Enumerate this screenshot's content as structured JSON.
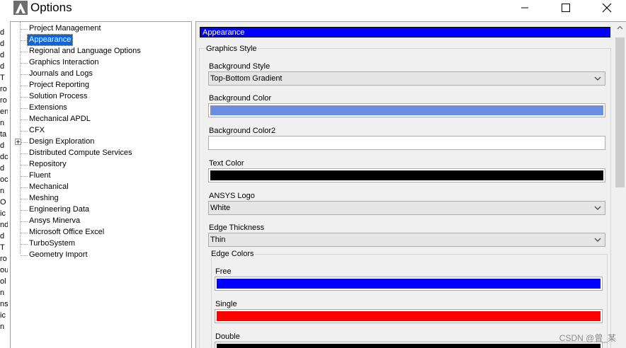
{
  "window": {
    "title": "Options",
    "controls": [
      "minimize",
      "maximize",
      "close"
    ]
  },
  "background_fragments": [
    "d",
    "d",
    "d",
    "d",
    "T",
    "ro",
    "ro",
    "en",
    "n",
    "ta",
    "d",
    "dc",
    "d",
    "oc",
    "n",
    "O",
    "ic",
    "nd",
    "d",
    "T",
    "ro",
    "ou",
    "ol",
    "n",
    "ns",
    "ic",
    "n"
  ],
  "tree": {
    "items": [
      {
        "label": "Project Management",
        "selected": false,
        "expandable": false
      },
      {
        "label": "Appearance",
        "selected": true,
        "expandable": false
      },
      {
        "label": "Regional and Language Options",
        "selected": false,
        "expandable": false
      },
      {
        "label": "Graphics Interaction",
        "selected": false,
        "expandable": false
      },
      {
        "label": "Journals and Logs",
        "selected": false,
        "expandable": false
      },
      {
        "label": "Project Reporting",
        "selected": false,
        "expandable": false
      },
      {
        "label": "Solution Process",
        "selected": false,
        "expandable": false
      },
      {
        "label": "Extensions",
        "selected": false,
        "expandable": false
      },
      {
        "label": "Mechanical APDL",
        "selected": false,
        "expandable": false
      },
      {
        "label": "CFX",
        "selected": false,
        "expandable": false
      },
      {
        "label": "Design Exploration",
        "selected": false,
        "expandable": true
      },
      {
        "label": "Distributed Compute Services",
        "selected": false,
        "expandable": false
      },
      {
        "label": "Repository",
        "selected": false,
        "expandable": false
      },
      {
        "label": "Fluent",
        "selected": false,
        "expandable": false
      },
      {
        "label": "Mechanical",
        "selected": false,
        "expandable": false
      },
      {
        "label": "Meshing",
        "selected": false,
        "expandable": false
      },
      {
        "label": "Engineering Data",
        "selected": false,
        "expandable": false
      },
      {
        "label": "Ansys Minerva",
        "selected": false,
        "expandable": false
      },
      {
        "label": "Microsoft Office Excel",
        "selected": false,
        "expandable": false
      },
      {
        "label": "TurboSystem",
        "selected": false,
        "expandable": false
      },
      {
        "label": "Geometry Import",
        "selected": false,
        "expandable": false
      }
    ]
  },
  "panel": {
    "header": "Appearance",
    "group_title": "Graphics Style",
    "background_style": {
      "label": "Background Style",
      "value": "Top-Bottom Gradient"
    },
    "background_color": {
      "label": "Background Color",
      "color": "#6b8ee3"
    },
    "background_color2": {
      "label": "Background Color2",
      "color": "#ffffff"
    },
    "text_color": {
      "label": "Text Color",
      "color": "#000000"
    },
    "ansys_logo": {
      "label": "ANSYS Logo",
      "value": "White"
    },
    "edge_thickness": {
      "label": "Edge Thickness",
      "value": "Thin"
    },
    "edge_colors": {
      "title": "Edge Colors",
      "free": {
        "label": "Free",
        "color": "#0000ff"
      },
      "single": {
        "label": "Single",
        "color": "#ff0000"
      },
      "double": {
        "label": "Double",
        "color": "#000000"
      }
    }
  },
  "watermark": "CSDN @曾_某"
}
